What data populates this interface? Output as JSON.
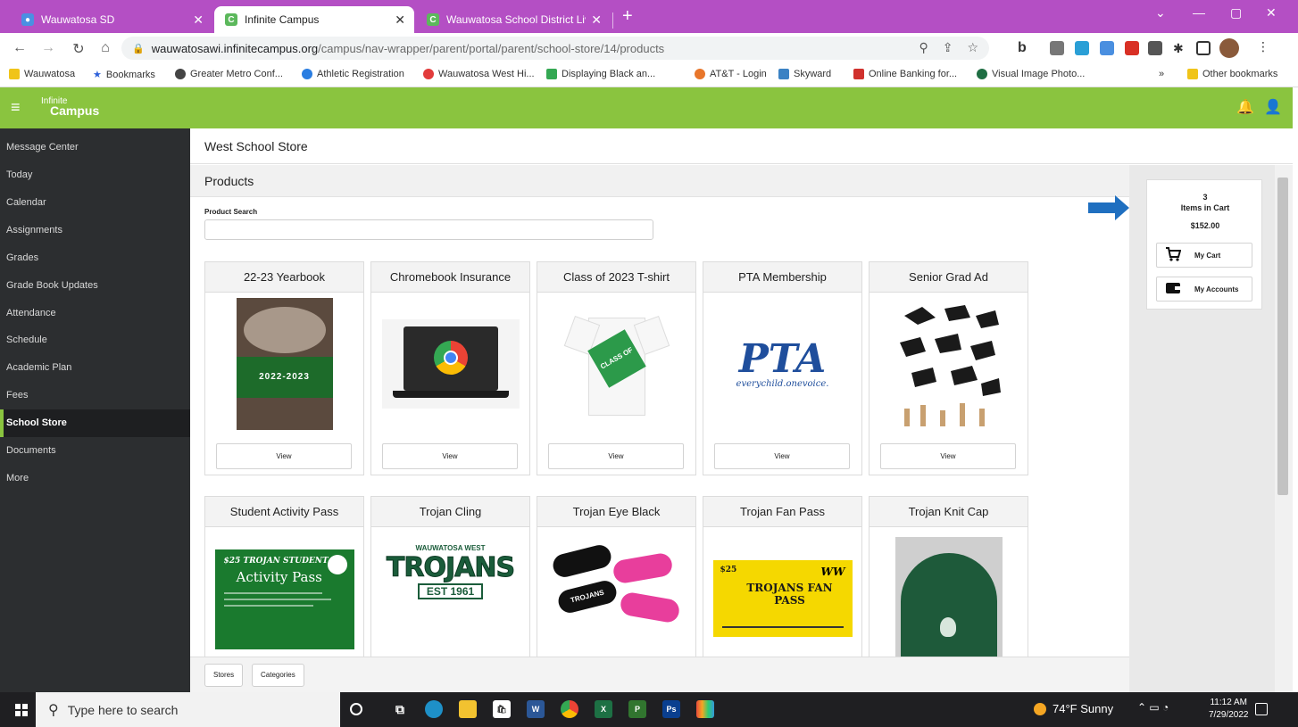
{
  "browser": {
    "tabs": [
      {
        "title": "Wauwatosa SD",
        "favicon_color": "#4a90e2",
        "active": false
      },
      {
        "title": "Infinite Campus",
        "favicon_color": "#5cb85c",
        "active": true
      },
      {
        "title": "Wauwatosa School District Live S",
        "favicon_color": "#5cb85c",
        "active": false
      }
    ],
    "new_tab": "+",
    "url_domain": "wauwatosawi.infinitecampus.org",
    "url_path": "/campus/nav-wrapper/parent/portal/parent/school-store/14/products",
    "bookmarks": [
      {
        "label": "Wauwatosa",
        "color": "#f0c419"
      },
      {
        "label": "Bookmarks",
        "color": "#2b5fd9"
      },
      {
        "label": "Greater Metro Conf...",
        "color": "#444444"
      },
      {
        "label": "Athletic Registration",
        "color": "#2a7de1"
      },
      {
        "label": "Wauwatosa West Hi...",
        "color": "#e23b3b"
      },
      {
        "label": "Displaying Black an...",
        "color": "#34a853"
      },
      {
        "label": "AT&T - Login",
        "color": "#e8762b"
      },
      {
        "label": "Skyward",
        "color": "#3b82c4"
      },
      {
        "label": "Online Banking for...",
        "color": "#d0312d"
      },
      {
        "label": "Visual Image Photo...",
        "color": "#1f6e43"
      }
    ],
    "more_bookmarks": "»",
    "other_bookmarks": "Other bookmarks"
  },
  "app": {
    "logo_line1": "Infinite",
    "logo_line2": "Campus",
    "header_color": "#8ac43f"
  },
  "sidebar": {
    "items": [
      {
        "label": "Message Center"
      },
      {
        "label": "Today"
      },
      {
        "label": "Calendar"
      },
      {
        "label": "Assignments"
      },
      {
        "label": "Grades"
      },
      {
        "label": "Grade Book Updates"
      },
      {
        "label": "Attendance"
      },
      {
        "label": "Schedule"
      },
      {
        "label": "Academic Plan"
      },
      {
        "label": "Fees"
      },
      {
        "label": "School Store"
      },
      {
        "label": "Documents"
      },
      {
        "label": "More"
      }
    ],
    "active": "School Store"
  },
  "page": {
    "title": "West School Store",
    "section_title": "Products",
    "search_label": "Product Search",
    "search_value": ""
  },
  "products": [
    {
      "name": "22-23 Yearbook",
      "view": "View",
      "image_text": "2022-2023"
    },
    {
      "name": "Chromebook Insurance",
      "view": "View"
    },
    {
      "name": "Class of 2023 T-shirt",
      "view": "View",
      "image_text": "CLASS OF"
    },
    {
      "name": "PTA Membership",
      "view": "View",
      "image_text": "PTA",
      "image_subtext": "everychild.onevoice."
    },
    {
      "name": "Senior Grad Ad",
      "view": "View"
    },
    {
      "name": "Student Activity Pass",
      "image_text": "$25 TROJAN STUDENT",
      "image_subtext": "Activity Pass"
    },
    {
      "name": "Trojan Cling",
      "image_text": "TROJANS",
      "image_subtext": "EST 1961",
      "image_top": "WAUWATOSA WEST"
    },
    {
      "name": "Trojan Eye Black",
      "image_text": "TROJANS"
    },
    {
      "name": "Trojan Fan Pass",
      "image_text": "$25",
      "image_subtext": "TROJANS FAN PASS"
    },
    {
      "name": "Trojan Knit Cap"
    }
  ],
  "bottom_nav": {
    "stores": "Stores",
    "categories": "Categories"
  },
  "cart": {
    "count": "3",
    "label": "Items in Cart",
    "total": "$152.00",
    "my_cart": "My Cart",
    "my_accounts": "My Accounts"
  },
  "taskbar": {
    "search_placeholder": "Type here to search",
    "weather": "74°F Sunny",
    "time": "11:12 AM",
    "date": "7/29/2022"
  }
}
